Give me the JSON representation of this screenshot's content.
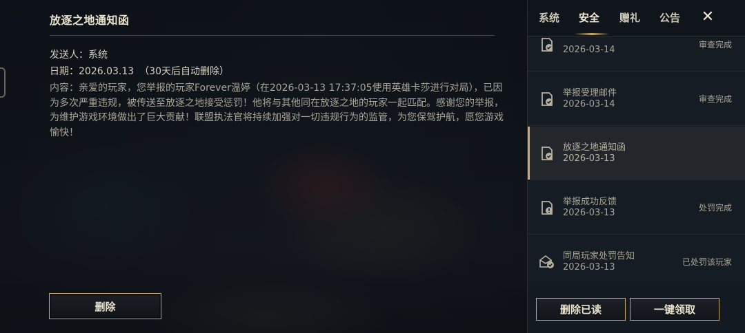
{
  "mail": {
    "title": "放逐之地通知函",
    "sender": "发送人：系统",
    "date": "日期：2026.03.13",
    "date_note": "（30天后自动删除）",
    "content": "内容：亲爱的玩家，您举报的玩家Forever温婷（在2026-03-13 17:37:05使用英雄卡莎进行对局），已因为多次严重违规，被传送至放逐之地接受惩罚！他将与其他同在放逐之地的玩家一起匹配。感谢您的举报，为维护游戏环境做出了巨大贡献！联盟执法官将持续加强对一切违规行为的监管，为您保驾护航，愿您游戏愉快！",
    "delete_label": "删除"
  },
  "tabs": [
    {
      "label": "系统"
    },
    {
      "label": "安全"
    },
    {
      "label": "赠礼"
    },
    {
      "label": "公告"
    }
  ],
  "active_tab": "安全",
  "close_label": "✕",
  "mails": [
    {
      "name": "",
      "date": "2026-03-14",
      "status": "审查完成",
      "icon": "report-check-icon"
    },
    {
      "name": "举报受理邮件",
      "date": "2026-03-14",
      "status": "审查完成",
      "icon": "report-check-icon"
    },
    {
      "name": "放逐之地通知函",
      "date": "2026-03-13",
      "status": "",
      "icon": "report-check-icon"
    },
    {
      "name": "举报成功反馈",
      "date": "2026-03-13",
      "status": "处罚完成",
      "icon": "report-alert-icon"
    },
    {
      "name": "同局玩家处罚告知",
      "date": "2026-03-13",
      "status": "已处罚该玩家",
      "icon": "envelope-check-icon"
    }
  ],
  "footer": {
    "delete_read_label": "删除已读",
    "claim_all_label": "一键领取"
  },
  "colors": {
    "accent_gold": "#c8aa6e",
    "panel_bg": "#141a21",
    "text_light": "#e8e2cf"
  }
}
